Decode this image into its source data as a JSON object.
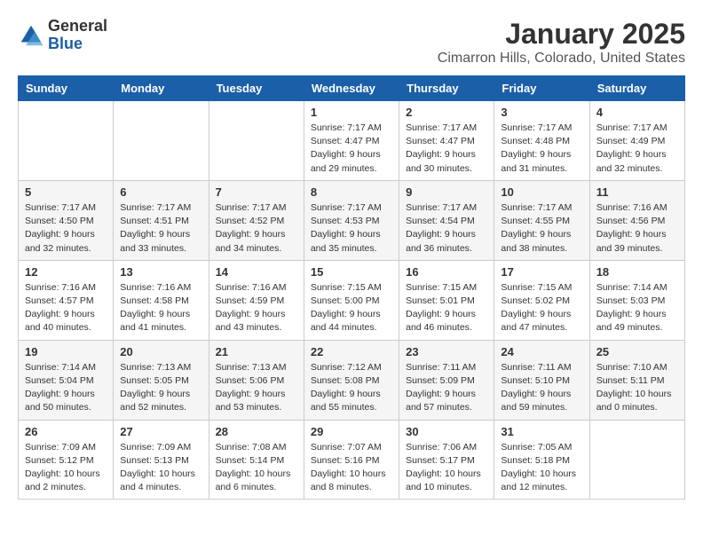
{
  "logo": {
    "general": "General",
    "blue": "Blue"
  },
  "title": "January 2025",
  "subtitle": "Cimarron Hills, Colorado, United States",
  "days_of_week": [
    "Sunday",
    "Monday",
    "Tuesday",
    "Wednesday",
    "Thursday",
    "Friday",
    "Saturday"
  ],
  "weeks": [
    [
      {
        "day": "",
        "info": ""
      },
      {
        "day": "",
        "info": ""
      },
      {
        "day": "",
        "info": ""
      },
      {
        "day": "1",
        "info": "Sunrise: 7:17 AM\nSunset: 4:47 PM\nDaylight: 9 hours\nand 29 minutes."
      },
      {
        "day": "2",
        "info": "Sunrise: 7:17 AM\nSunset: 4:47 PM\nDaylight: 9 hours\nand 30 minutes."
      },
      {
        "day": "3",
        "info": "Sunrise: 7:17 AM\nSunset: 4:48 PM\nDaylight: 9 hours\nand 31 minutes."
      },
      {
        "day": "4",
        "info": "Sunrise: 7:17 AM\nSunset: 4:49 PM\nDaylight: 9 hours\nand 32 minutes."
      }
    ],
    [
      {
        "day": "5",
        "info": "Sunrise: 7:17 AM\nSunset: 4:50 PM\nDaylight: 9 hours\nand 32 minutes."
      },
      {
        "day": "6",
        "info": "Sunrise: 7:17 AM\nSunset: 4:51 PM\nDaylight: 9 hours\nand 33 minutes."
      },
      {
        "day": "7",
        "info": "Sunrise: 7:17 AM\nSunset: 4:52 PM\nDaylight: 9 hours\nand 34 minutes."
      },
      {
        "day": "8",
        "info": "Sunrise: 7:17 AM\nSunset: 4:53 PM\nDaylight: 9 hours\nand 35 minutes."
      },
      {
        "day": "9",
        "info": "Sunrise: 7:17 AM\nSunset: 4:54 PM\nDaylight: 9 hours\nand 36 minutes."
      },
      {
        "day": "10",
        "info": "Sunrise: 7:17 AM\nSunset: 4:55 PM\nDaylight: 9 hours\nand 38 minutes."
      },
      {
        "day": "11",
        "info": "Sunrise: 7:16 AM\nSunset: 4:56 PM\nDaylight: 9 hours\nand 39 minutes."
      }
    ],
    [
      {
        "day": "12",
        "info": "Sunrise: 7:16 AM\nSunset: 4:57 PM\nDaylight: 9 hours\nand 40 minutes."
      },
      {
        "day": "13",
        "info": "Sunrise: 7:16 AM\nSunset: 4:58 PM\nDaylight: 9 hours\nand 41 minutes."
      },
      {
        "day": "14",
        "info": "Sunrise: 7:16 AM\nSunset: 4:59 PM\nDaylight: 9 hours\nand 43 minutes."
      },
      {
        "day": "15",
        "info": "Sunrise: 7:15 AM\nSunset: 5:00 PM\nDaylight: 9 hours\nand 44 minutes."
      },
      {
        "day": "16",
        "info": "Sunrise: 7:15 AM\nSunset: 5:01 PM\nDaylight: 9 hours\nand 46 minutes."
      },
      {
        "day": "17",
        "info": "Sunrise: 7:15 AM\nSunset: 5:02 PM\nDaylight: 9 hours\nand 47 minutes."
      },
      {
        "day": "18",
        "info": "Sunrise: 7:14 AM\nSunset: 5:03 PM\nDaylight: 9 hours\nand 49 minutes."
      }
    ],
    [
      {
        "day": "19",
        "info": "Sunrise: 7:14 AM\nSunset: 5:04 PM\nDaylight: 9 hours\nand 50 minutes."
      },
      {
        "day": "20",
        "info": "Sunrise: 7:13 AM\nSunset: 5:05 PM\nDaylight: 9 hours\nand 52 minutes."
      },
      {
        "day": "21",
        "info": "Sunrise: 7:13 AM\nSunset: 5:06 PM\nDaylight: 9 hours\nand 53 minutes."
      },
      {
        "day": "22",
        "info": "Sunrise: 7:12 AM\nSunset: 5:08 PM\nDaylight: 9 hours\nand 55 minutes."
      },
      {
        "day": "23",
        "info": "Sunrise: 7:11 AM\nSunset: 5:09 PM\nDaylight: 9 hours\nand 57 minutes."
      },
      {
        "day": "24",
        "info": "Sunrise: 7:11 AM\nSunset: 5:10 PM\nDaylight: 9 hours\nand 59 minutes."
      },
      {
        "day": "25",
        "info": "Sunrise: 7:10 AM\nSunset: 5:11 PM\nDaylight: 10 hours\nand 0 minutes."
      }
    ],
    [
      {
        "day": "26",
        "info": "Sunrise: 7:09 AM\nSunset: 5:12 PM\nDaylight: 10 hours\nand 2 minutes."
      },
      {
        "day": "27",
        "info": "Sunrise: 7:09 AM\nSunset: 5:13 PM\nDaylight: 10 hours\nand 4 minutes."
      },
      {
        "day": "28",
        "info": "Sunrise: 7:08 AM\nSunset: 5:14 PM\nDaylight: 10 hours\nand 6 minutes."
      },
      {
        "day": "29",
        "info": "Sunrise: 7:07 AM\nSunset: 5:16 PM\nDaylight: 10 hours\nand 8 minutes."
      },
      {
        "day": "30",
        "info": "Sunrise: 7:06 AM\nSunset: 5:17 PM\nDaylight: 10 hours\nand 10 minutes."
      },
      {
        "day": "31",
        "info": "Sunrise: 7:05 AM\nSunset: 5:18 PM\nDaylight: 10 hours\nand 12 minutes."
      },
      {
        "day": "",
        "info": ""
      }
    ]
  ]
}
